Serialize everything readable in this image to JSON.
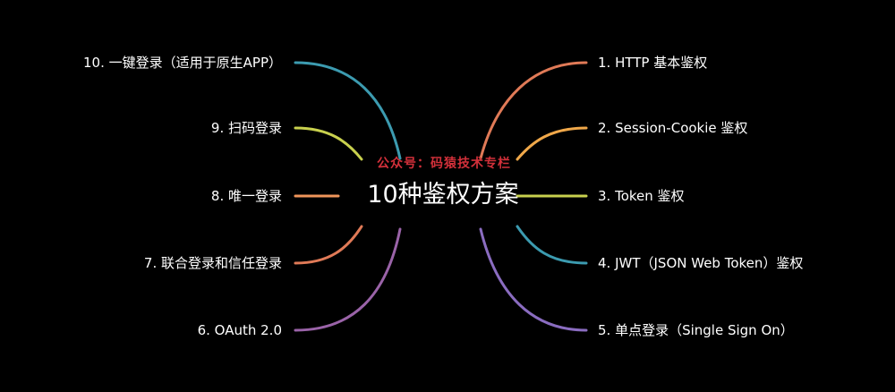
{
  "title": "10种鉴权方案",
  "watermark": "公众号：码猿技术专栏",
  "colors": {
    "background": "#000000",
    "text": "#ffffff",
    "watermark": "#d2303a"
  },
  "branches": {
    "right": [
      {
        "label": "1. HTTP 基本鉴权",
        "color": "#e07a57"
      },
      {
        "label": "2. Session-Cookie 鉴权",
        "color": "#f0a84a"
      },
      {
        "label": "3. Token 鉴权",
        "color": "#c9d14e"
      },
      {
        "label": "4. JWT（JSON Web Token）鉴权",
        "color": "#3c9bb0"
      },
      {
        "label": "5. 单点登录（Single Sign On）",
        "color": "#8a6cc0"
      }
    ],
    "left": [
      {
        "label": "10. 一键登录（适用于原生APP）",
        "color": "#3c9bb0"
      },
      {
        "label": "9. 扫码登录",
        "color": "#c9d14e"
      },
      {
        "label": "8. 唯一登录",
        "color": "#f0955a"
      },
      {
        "label": "7. 联合登录和信任登录",
        "color": "#e07a57"
      },
      {
        "label": "6. OAuth 2.0",
        "color": "#9a63a8"
      }
    ]
  }
}
